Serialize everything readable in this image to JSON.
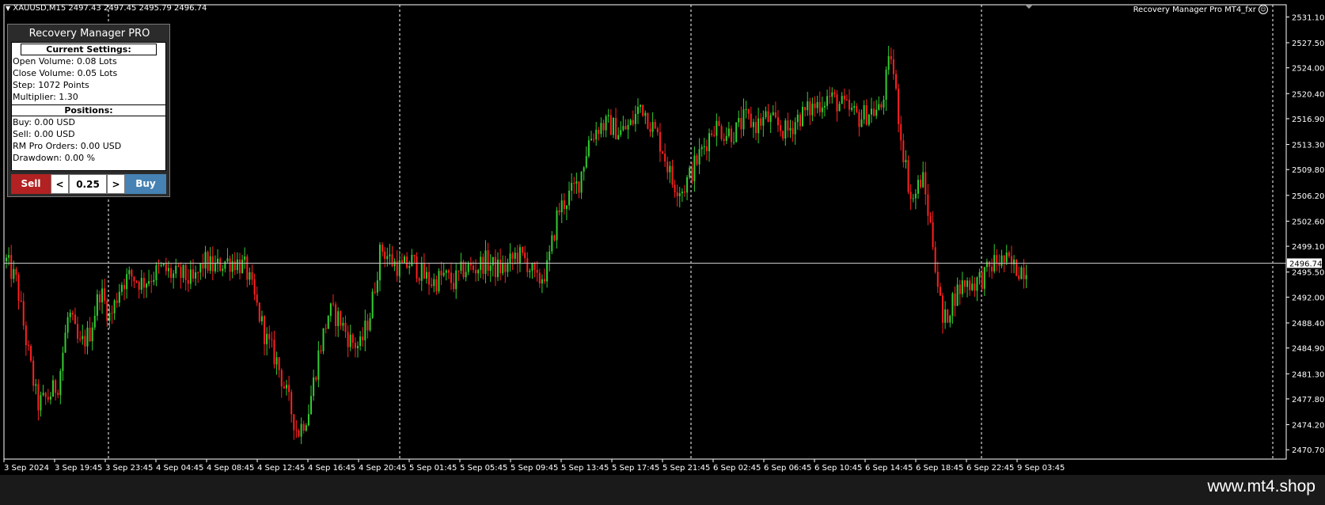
{
  "chart": {
    "symbol_info": "XAUUSD,M15  2497.43 2497.45 2495.79 2496.74",
    "ea_label": "Recovery Manager Pro MT4_fxr",
    "current_price": "2496.74",
    "price_levels": [
      "2531.10",
      "2527.50",
      "2524.00",
      "2520.40",
      "2516.90",
      "2513.30",
      "2509.80",
      "2506.20",
      "2502.60",
      "2499.10",
      "2495.50",
      "2492.00",
      "2488.40",
      "2484.90",
      "2481.30",
      "2477.80",
      "2474.20",
      "2470.70"
    ],
    "time_labels": [
      "3 Sep 2024",
      "3 Sep 19:45",
      "3 Sep 23:45",
      "4 Sep 04:45",
      "4 Sep 08:45",
      "4 Sep 12:45",
      "4 Sep 16:45",
      "4 Sep 20:45",
      "5 Sep 01:45",
      "5 Sep 05:45",
      "5 Sep 09:45",
      "5 Sep 13:45",
      "5 Sep 17:45",
      "5 Sep 21:45",
      "6 Sep 02:45",
      "6 Sep 06:45",
      "6 Sep 10:45",
      "6 Sep 14:45",
      "6 Sep 18:45",
      "6 Sep 22:45",
      "9 Sep 03:45"
    ],
    "colors": {
      "bull": "#32cd32",
      "bear": "#ff2020",
      "axis": "#ffffff",
      "background": "#000000"
    }
  },
  "chart_data": {
    "type": "candlestick",
    "y_range": [
      2470.7,
      2531.1
    ],
    "close_path": [
      [
        0,
        2497
      ],
      [
        1,
        2494
      ],
      [
        2,
        2485
      ],
      [
        3,
        2477
      ],
      [
        4,
        2478
      ],
      [
        5,
        2480
      ],
      [
        6,
        2490
      ],
      [
        7,
        2485
      ],
      [
        8,
        2487
      ],
      [
        9,
        2493
      ],
      [
        10,
        2489
      ],
      [
        11,
        2494
      ],
      [
        12,
        2495
      ],
      [
        13,
        2494
      ],
      [
        14,
        2495
      ],
      [
        15,
        2496
      ],
      [
        16,
        2495
      ],
      [
        17,
        2495
      ],
      [
        18,
        2494
      ],
      [
        19,
        2497
      ],
      [
        20,
        2496
      ],
      [
        21,
        2497
      ],
      [
        22,
        2497
      ],
      [
        23,
        2496
      ],
      [
        24,
        2491
      ],
      [
        25,
        2486
      ],
      [
        26,
        2483
      ],
      [
        27,
        2478
      ],
      [
        28,
        2473
      ],
      [
        29,
        2476
      ],
      [
        30,
        2484
      ],
      [
        31,
        2490
      ],
      [
        32,
        2489
      ],
      [
        33,
        2486
      ],
      [
        34,
        2485
      ],
      [
        35,
        2490
      ],
      [
        36,
        2499
      ],
      [
        37,
        2497
      ],
      [
        38,
        2496
      ],
      [
        39,
        2497
      ],
      [
        40,
        2495
      ],
      [
        41,
        2494
      ],
      [
        42,
        2495
      ],
      [
        43,
        2494
      ],
      [
        44,
        2496
      ],
      [
        45,
        2496
      ],
      [
        46,
        2497
      ],
      [
        47,
        2496
      ],
      [
        48,
        2496
      ],
      [
        49,
        2498
      ],
      [
        50,
        2497
      ],
      [
        51,
        2494
      ],
      [
        52,
        2496
      ],
      [
        53,
        2504
      ],
      [
        54,
        2506
      ],
      [
        55,
        2508
      ],
      [
        56,
        2514
      ],
      [
        57,
        2516
      ],
      [
        58,
        2516
      ],
      [
        59,
        2515
      ],
      [
        60,
        2516
      ],
      [
        61,
        2519
      ],
      [
        62,
        2516
      ],
      [
        63,
        2513
      ],
      [
        64,
        2508
      ],
      [
        65,
        2507
      ],
      [
        66,
        2510
      ],
      [
        67,
        2513
      ],
      [
        68,
        2516
      ],
      [
        69,
        2515
      ],
      [
        70,
        2515
      ],
      [
        71,
        2517
      ],
      [
        72,
        2516
      ],
      [
        73,
        2517
      ],
      [
        74,
        2516
      ],
      [
        75,
        2515
      ],
      [
        76,
        2517
      ],
      [
        77,
        2518
      ],
      [
        78,
        2519
      ],
      [
        79,
        2520
      ],
      [
        80,
        2519
      ],
      [
        81,
        2518
      ],
      [
        82,
        2517
      ],
      [
        83,
        2518
      ],
      [
        84,
        2518
      ],
      [
        85,
        2526
      ],
      [
        86,
        2514
      ],
      [
        87,
        2505
      ],
      [
        88,
        2509
      ],
      [
        89,
        2500
      ],
      [
        90,
        2488
      ],
      [
        91,
        2492
      ],
      [
        92,
        2494
      ],
      [
        93,
        2494
      ],
      [
        94,
        2495
      ],
      [
        95,
        2497
      ],
      [
        96,
        2497
      ],
      [
        97,
        2496
      ],
      [
        98,
        2496
      ]
    ]
  },
  "panel": {
    "title": "Recovery Manager PRO",
    "settings_header": "Current Settings:",
    "open_volume": "Open Volume: 0.08 Lots",
    "close_volume": "Close Volume: 0.05 Lots",
    "step": "Step: 1072 Points",
    "multiplier": "Multiplier: 1.30",
    "positions_header": "Positions:",
    "buy": "Buy: 0.00 USD",
    "sell": "Sell: 0.00 USD",
    "rm_orders": "RM Pro Orders: 0.00 USD",
    "drawdown": "Drawdown: 0.00 %",
    "sell_label": "Sell",
    "dec_label": "<",
    "lot_value": "0.25",
    "inc_label": ">",
    "buy_label": "Buy",
    "colors": {
      "sell": "#b22222",
      "buy": "#4682b4"
    }
  },
  "watermark": "www.mt4.shop"
}
